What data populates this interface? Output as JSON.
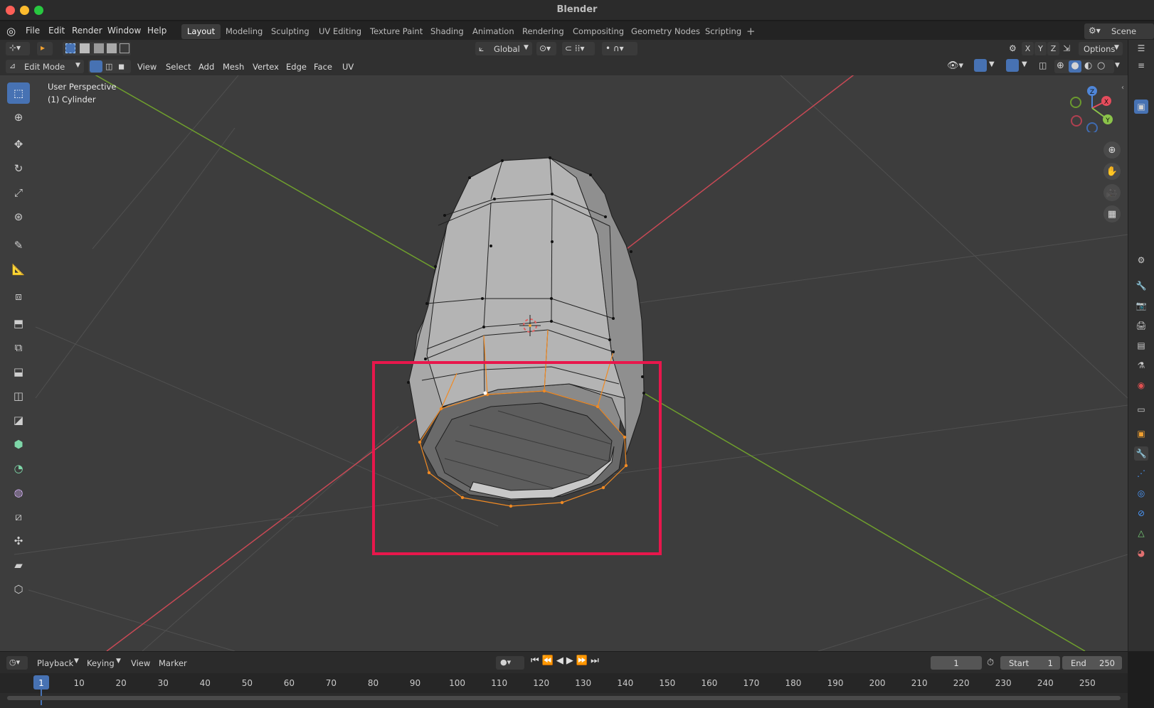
{
  "app": {
    "title": "Blender"
  },
  "menu": {
    "file": "File",
    "edit": "Edit",
    "render": "Render",
    "window": "Window",
    "help": "Help"
  },
  "workspaces": [
    "Layout",
    "Modeling",
    "Sculpting",
    "UV Editing",
    "Texture Paint",
    "Shading",
    "Animation",
    "Rendering",
    "Compositing",
    "Geometry Nodes",
    "Scripting"
  ],
  "scene": {
    "label": "Scene"
  },
  "header": {
    "orientation": "Global",
    "options": "Options",
    "axis_x": "X",
    "axis_y": "Y",
    "axis_z": "Z"
  },
  "modebar": {
    "mode": "Edit Mode",
    "view": "View",
    "select": "Select",
    "add": "Add",
    "mesh": "Mesh",
    "vertex": "Vertex",
    "edge": "Edge",
    "face": "Face",
    "uv": "UV"
  },
  "viewport": {
    "perspective": "User Perspective",
    "object": "(1) Cylinder"
  },
  "gizmo": {
    "x": "X",
    "y": "Y",
    "z": "Z"
  },
  "timeline": {
    "playback": "Playback",
    "keying": "Keying",
    "view": "View",
    "marker": "Marker",
    "current_frame": "1",
    "start_label": "Start",
    "start": "1",
    "end_label": "End",
    "end": "250",
    "ticks": [
      "1",
      "10",
      "20",
      "30",
      "40",
      "50",
      "60",
      "70",
      "80",
      "90",
      "100",
      "110",
      "120",
      "130",
      "140",
      "150",
      "160",
      "170",
      "180",
      "190",
      "200",
      "210",
      "220",
      "230",
      "240",
      "250"
    ]
  },
  "colors": {
    "accent": "#4772b3",
    "selection": "#f08a24",
    "highlight_box": "#e8174c"
  }
}
